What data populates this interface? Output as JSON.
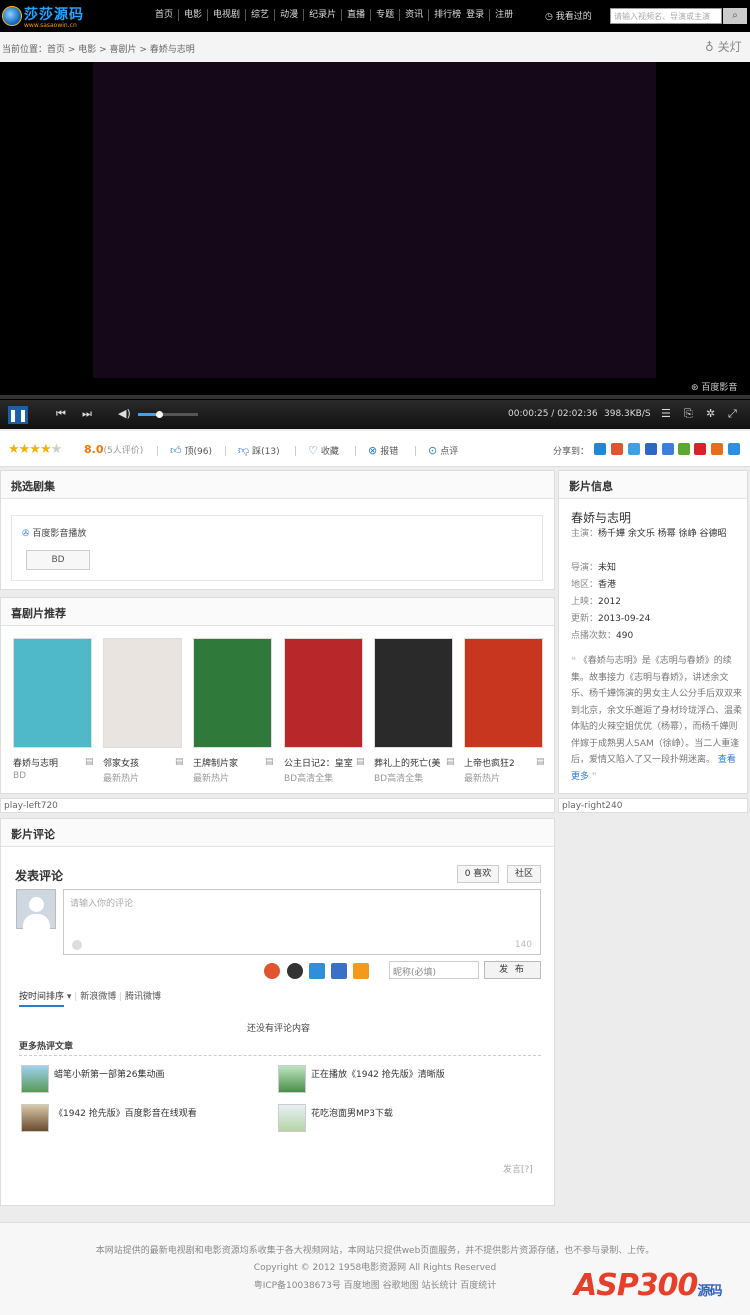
{
  "site": {
    "logo_text": "莎莎源码",
    "logo_sub": "www.sasaowin.cn"
  },
  "nav": [
    "首页",
    "电影",
    "电视剧",
    "综艺",
    "动漫",
    "纪录片",
    "直播",
    "专题",
    "资讯",
    "排行榜",
    "登录",
    "注册"
  ],
  "watched": "我看过的",
  "search": {
    "placeholder": "请输入视频名、导演或主演"
  },
  "breadcrumb": "当前位置：首页 > 电影 > 喜剧片 > 春娇与志明",
  "lights_off": "关灯",
  "player": {
    "brand": "百度影音",
    "current_time": "00:00:25",
    "duration": "02:02:36",
    "speed": "398.3KB/S",
    "volume_fraction": 0.35
  },
  "rating": {
    "score": "8.0",
    "count": "(5人评价)",
    "stars": 4
  },
  "actions": {
    "up": "顶(96)",
    "down": "踩(13)",
    "fav": "收藏",
    "report": "报错",
    "comment": "点评"
  },
  "share_label": "分享到：",
  "episodes": {
    "title": "挑选剧集",
    "source": "百度影音播放",
    "ep": "BD"
  },
  "recommend": {
    "title": "喜剧片推荐",
    "items": [
      {
        "title": "春娇与志明",
        "sub": "BD",
        "color": "#4fb8c9"
      },
      {
        "title": "邻家女孩",
        "sub": "最新热片",
        "color": "#e9e4e0"
      },
      {
        "title": "王牌制片家",
        "sub": "最新热片",
        "color": "#2f7a3a"
      },
      {
        "title": "公主日记2：皇室",
        "sub": "BD高清全集",
        "color": "#b8272a"
      },
      {
        "title": "葬礼上的死亡(美",
        "sub": "BD高清全集",
        "color": "#2a2a2a"
      },
      {
        "title": "上帝也疯狂2",
        "sub": "最新热片",
        "color": "#c8361f"
      }
    ]
  },
  "placeholders": {
    "left": "play-left720",
    "right": "play-right240"
  },
  "info": {
    "head": "影片信息",
    "title": "春娇与志明",
    "cast_label": "主演：",
    "cast": "杨千嬅 余文乐 杨幂 徐峥 谷德昭",
    "director_label": "导演：",
    "director": "未知",
    "region_label": "地区：",
    "region": "香港",
    "year_label": "上映：",
    "year": "2012",
    "updated_label": "更新：",
    "updated": "2013-09-24",
    "plays_label": "点播次数：",
    "plays": "490",
    "desc": "《春娇与志明》是《志明与春娇》的续集。故事接力《志明与春娇》，讲述余文乐、杨千嬅饰演的男女主人公分手后双双来到北京，余文乐邂逅了身材玲珑浮凸、温柔体贴的火辣空姐优优（杨幂），而杨千嬅则伴嫁于成熟男人SAM（徐峥）。当二人重逢后，爱情又陷入了又一段扑朔迷离。",
    "more": "查看更多"
  },
  "comments": {
    "head": "影片评论",
    "post_title": "发表评论",
    "like": "0 喜欢",
    "community": "社区",
    "placeholder": "请输入你的评论",
    "counter": "140",
    "nickname": "昵称(必填)",
    "publish": "发 布",
    "tabs": [
      "按时间排序",
      "新浪微博",
      "腾讯微博"
    ],
    "empty": "还没有评论内容",
    "more_title": "更多热评文章",
    "hot": [
      "蜡笔小新第一部第26集动画",
      "正在播放《1942 抢先版》清晰版",
      "《1942 抢先版》百度影音在线观看",
      "花吃泡面男MP3下载"
    ],
    "report": "发言[?]"
  },
  "footer": {
    "line1": "本网站提供的最新电视剧和电影资源均系收集于各大视频网站，本网站只提供web页面服务，并不提供影片资源存储，也不参与录制、上传。",
    "line2": "Copyright © 2012 1958电影资源网  All Rights Reserved",
    "line3": "粤ICP备10038673号 百度地图 谷歌地图 站长统计 百度统计",
    "brand": "ASP300",
    "brand_sub": "源码"
  }
}
